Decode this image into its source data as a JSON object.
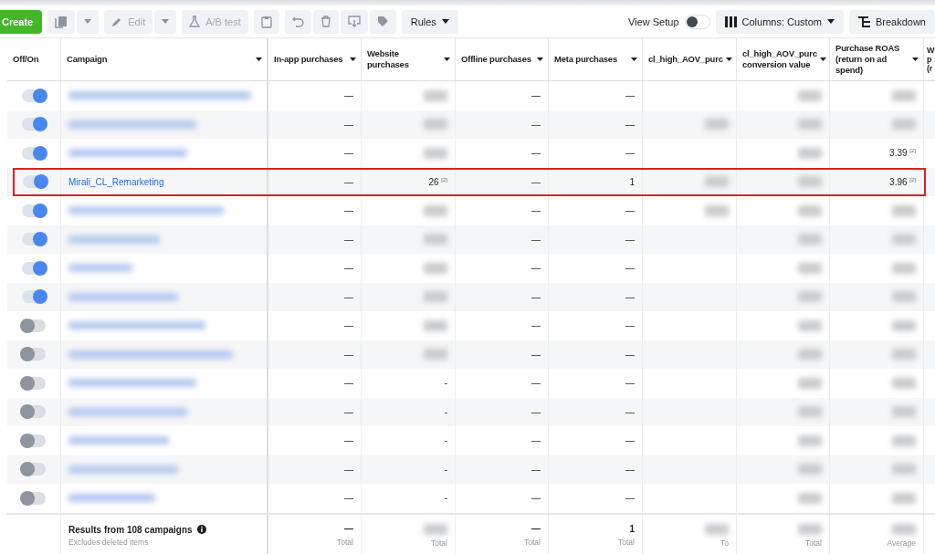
{
  "toolbar": {
    "create": "Create",
    "edit": "Edit",
    "ab_test": "A/B test",
    "rules": "Rules",
    "view_setup": {
      "label": "View Setup",
      "on": false
    },
    "columns": "Columns: Custom",
    "breakdown": "Breakdown"
  },
  "table": {
    "columns": [
      {
        "label": "Off/On",
        "sortable": false
      },
      {
        "label": "Campaign",
        "sortable": true
      },
      {
        "label": "In-app purchases",
        "sortable": true
      },
      {
        "label": "Website purchases",
        "sortable": true
      },
      {
        "label": "Offline purchases",
        "sortable": true
      },
      {
        "label": "Meta purchases",
        "sortable": true
      },
      {
        "label": "cl_high_AOV_purc",
        "sortable": true
      },
      {
        "label": "cl_high_AOV_purc conversion value",
        "sortable": true
      },
      {
        "label": "Purchase ROAS (return on ad spend)",
        "sortable": true
      },
      {
        "label": "W p (r"
      }
    ],
    "rows": [
      {
        "on": true,
        "highlighted": false,
        "campaign": {
          "kind": "blurred"
        },
        "cells": [
          {
            "kind": "text",
            "text": "—"
          },
          {
            "kind": "blurred"
          },
          {
            "kind": "text",
            "text": "—"
          },
          {
            "kind": "text",
            "text": "—"
          },
          {
            "kind": "empty"
          },
          {
            "kind": "blurred"
          },
          {
            "kind": "blurred"
          }
        ]
      },
      {
        "on": true,
        "highlighted": false,
        "campaign": {
          "kind": "blurred"
        },
        "cells": [
          {
            "kind": "text",
            "text": "—"
          },
          {
            "kind": "blurred"
          },
          {
            "kind": "text",
            "text": "—"
          },
          {
            "kind": "text",
            "text": "—"
          },
          {
            "kind": "blurred"
          },
          {
            "kind": "blurred"
          },
          {
            "kind": "blurred"
          }
        ]
      },
      {
        "on": true,
        "highlighted": false,
        "campaign": {
          "kind": "blurred"
        },
        "cells": [
          {
            "kind": "text",
            "text": "—"
          },
          {
            "kind": "blurred"
          },
          {
            "kind": "text",
            "text": "—"
          },
          {
            "kind": "text",
            "text": "—"
          },
          {
            "kind": "empty"
          },
          {
            "kind": "blurred"
          },
          {
            "kind": "text",
            "text": "3.39 $^{[2]}$"
          }
        ]
      },
      {
        "on": true,
        "highlighted": true,
        "campaign": {
          "kind": "text",
          "text": "Mirali_CL_Remarketing"
        },
        "cells": [
          {
            "kind": "text",
            "text": "—"
          },
          {
            "kind": "text",
            "text": "26 $^{[2]}$"
          },
          {
            "kind": "text",
            "text": "—"
          },
          {
            "kind": "text",
            "text": "1"
          },
          {
            "kind": "blurred"
          },
          {
            "kind": "blurred"
          },
          {
            "kind": "text",
            "text": "3.96 $^{[2]}$"
          }
        ]
      },
      {
        "on": true,
        "highlighted": false,
        "campaign": {
          "kind": "blurred"
        },
        "cells": [
          {
            "kind": "text",
            "text": "—"
          },
          {
            "kind": "blurred"
          },
          {
            "kind": "text",
            "text": "—"
          },
          {
            "kind": "text",
            "text": "—"
          },
          {
            "kind": "blurred"
          },
          {
            "kind": "blurred"
          },
          {
            "kind": "blurred"
          }
        ]
      },
      {
        "on": true,
        "highlighted": false,
        "campaign": {
          "kind": "blurred"
        },
        "cells": [
          {
            "kind": "text",
            "text": "—"
          },
          {
            "kind": "blurred"
          },
          {
            "kind": "text",
            "text": "—"
          },
          {
            "kind": "text",
            "text": "—"
          },
          {
            "kind": "empty"
          },
          {
            "kind": "blurred"
          },
          {
            "kind": "blurred"
          }
        ]
      },
      {
        "on": true,
        "highlighted": false,
        "campaign": {
          "kind": "blurred"
        },
        "cells": [
          {
            "kind": "text",
            "text": "—"
          },
          {
            "kind": "blurred"
          },
          {
            "kind": "text",
            "text": "—"
          },
          {
            "kind": "text",
            "text": "—"
          },
          {
            "kind": "empty"
          },
          {
            "kind": "blurred"
          },
          {
            "kind": "blurred"
          }
        ]
      },
      {
        "on": true,
        "highlighted": false,
        "campaign": {
          "kind": "blurred"
        },
        "cells": [
          {
            "kind": "text",
            "text": "—"
          },
          {
            "kind": "blurred"
          },
          {
            "kind": "text",
            "text": "—"
          },
          {
            "kind": "text",
            "text": "—"
          },
          {
            "kind": "empty"
          },
          {
            "kind": "blurred"
          },
          {
            "kind": "blurred"
          }
        ]
      },
      {
        "on": false,
        "highlighted": false,
        "campaign": {
          "kind": "blurred"
        },
        "cells": [
          {
            "kind": "text",
            "text": "—"
          },
          {
            "kind": "blurred"
          },
          {
            "kind": "text",
            "text": "—"
          },
          {
            "kind": "text",
            "text": "—"
          },
          {
            "kind": "empty"
          },
          {
            "kind": "blurred"
          },
          {
            "kind": "blurred"
          }
        ]
      },
      {
        "on": false,
        "highlighted": false,
        "campaign": {
          "kind": "blurred"
        },
        "cells": [
          {
            "kind": "text",
            "text": "—"
          },
          {
            "kind": "blurred"
          },
          {
            "kind": "text",
            "text": "—"
          },
          {
            "kind": "text",
            "text": "—"
          },
          {
            "kind": "empty"
          },
          {
            "kind": "blurred"
          },
          {
            "kind": "blurred"
          }
        ]
      },
      {
        "on": false,
        "highlighted": false,
        "campaign": {
          "kind": "blurred"
        },
        "cells": [
          {
            "kind": "text",
            "text": "—"
          },
          {
            "kind": "text",
            "text": "-"
          },
          {
            "kind": "text",
            "text": "—"
          },
          {
            "kind": "text",
            "text": "—"
          },
          {
            "kind": "empty"
          },
          {
            "kind": "blurred"
          },
          {
            "kind": "blurred"
          }
        ]
      },
      {
        "on": false,
        "highlighted": false,
        "campaign": {
          "kind": "blurred"
        },
        "cells": [
          {
            "kind": "text",
            "text": "—"
          },
          {
            "kind": "text",
            "text": "-"
          },
          {
            "kind": "text",
            "text": "—"
          },
          {
            "kind": "text",
            "text": "—"
          },
          {
            "kind": "empty"
          },
          {
            "kind": "blurred"
          },
          {
            "kind": "blurred"
          }
        ]
      },
      {
        "on": false,
        "highlighted": false,
        "campaign": {
          "kind": "blurred"
        },
        "cells": [
          {
            "kind": "text",
            "text": "—"
          },
          {
            "kind": "text",
            "text": "-"
          },
          {
            "kind": "text",
            "text": "—"
          },
          {
            "kind": "text",
            "text": "—"
          },
          {
            "kind": "empty"
          },
          {
            "kind": "blurred"
          },
          {
            "kind": "blurred"
          }
        ]
      },
      {
        "on": false,
        "highlighted": false,
        "campaign": {
          "kind": "blurred"
        },
        "cells": [
          {
            "kind": "text",
            "text": "—"
          },
          {
            "kind": "text",
            "text": "-"
          },
          {
            "kind": "text",
            "text": "—"
          },
          {
            "kind": "text",
            "text": "—"
          },
          {
            "kind": "empty"
          },
          {
            "kind": "blurred"
          },
          {
            "kind": "blurred"
          }
        ]
      },
      {
        "on": false,
        "highlighted": false,
        "campaign": {
          "kind": "blurred"
        },
        "cells": [
          {
            "kind": "text",
            "text": "—"
          },
          {
            "kind": "text",
            "text": "-"
          },
          {
            "kind": "text",
            "text": "—"
          },
          {
            "kind": "text",
            "text": "—"
          },
          {
            "kind": "empty"
          },
          {
            "kind": "blurred"
          },
          {
            "kind": "blurred"
          }
        ]
      }
    ],
    "footer": {
      "title": "Results from 108 campaigns",
      "subtitle": "Excludes deleted items",
      "totals": [
        {
          "kind": "text",
          "value": "—",
          "label": "Total"
        },
        {
          "kind": "blurred",
          "label": "Total"
        },
        {
          "kind": "text",
          "value": "—",
          "label": "Total"
        },
        {
          "kind": "text",
          "value": "1",
          "label": "Total"
        },
        {
          "kind": "blurred",
          "label": "To"
        },
        {
          "kind": "blurred",
          "label": "Total"
        },
        {
          "kind": "blurred",
          "label": "Average"
        }
      ]
    }
  }
}
